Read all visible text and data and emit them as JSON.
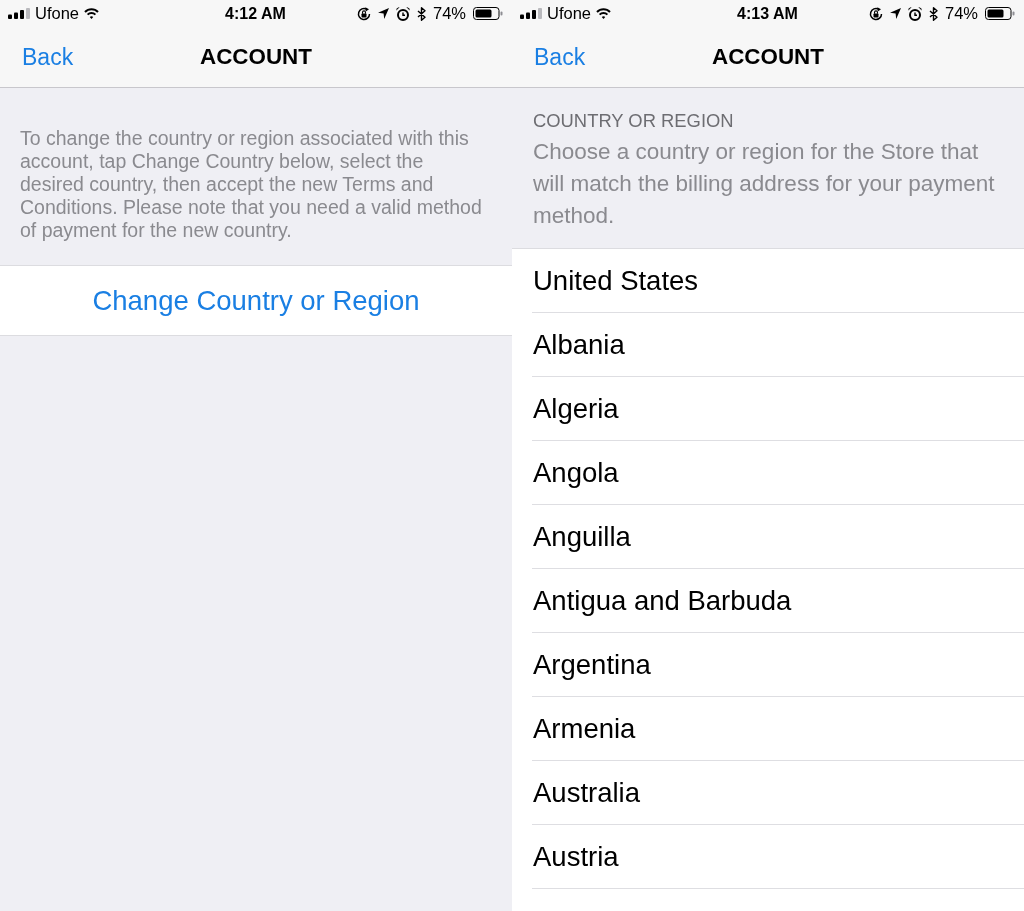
{
  "screens": [
    {
      "kind": "account",
      "status_bar": {
        "carrier": "Ufone",
        "time": "4:12 AM",
        "battery": "74%"
      },
      "nav_bar": {
        "back": "Back",
        "title": "ACCOUNT"
      },
      "description": "To change the country or region associated with this account, tap Change Country below, select the desired country, then accept the new Terms and Conditions. Please note that you need a valid method of payment for the new country.",
      "action": "Change Country or Region"
    },
    {
      "kind": "country_list",
      "status_bar": {
        "carrier": "Ufone",
        "time": "4:13 AM",
        "battery": "74%"
      },
      "nav_bar": {
        "back": "Back",
        "title": "ACCOUNT"
      },
      "section_header": "COUNTRY OR REGION",
      "description": "Choose a country or region for the Store that will match the billing address for your payment method.",
      "countries": [
        "United States",
        "Albania",
        "Algeria",
        "Angola",
        "Anguilla",
        "Antigua and Barbuda",
        "Argentina",
        "Armenia",
        "Australia",
        "Austria"
      ]
    }
  ]
}
